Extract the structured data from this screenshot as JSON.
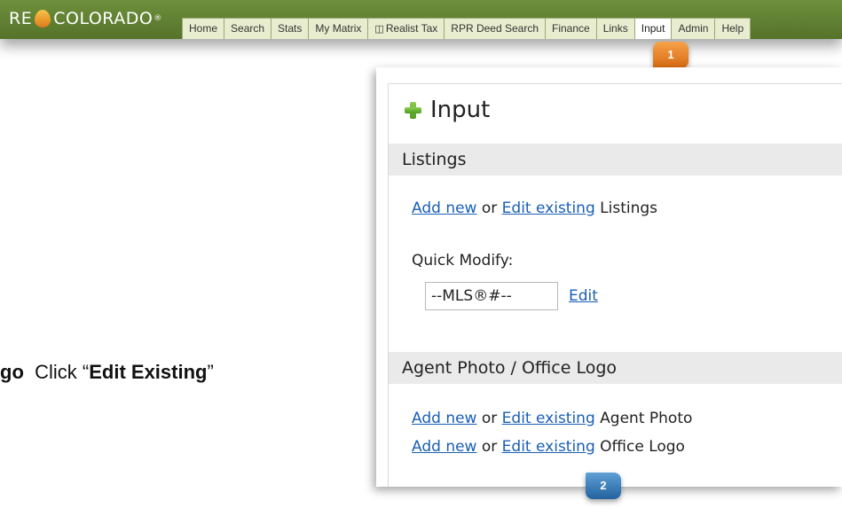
{
  "logo": {
    "part1": "RE",
    "part2": "COLORADO",
    "reg": "®"
  },
  "nav": {
    "tabs": [
      {
        "label": "Home"
      },
      {
        "label": "Search"
      },
      {
        "label": "Stats"
      },
      {
        "label": "My Matrix"
      },
      {
        "label": "Realist Tax"
      },
      {
        "label": "RPR Deed Search"
      },
      {
        "label": "Finance"
      },
      {
        "label": "Links"
      },
      {
        "label": "Input"
      },
      {
        "label": "Admin"
      },
      {
        "label": "Help"
      }
    ],
    "active": "Input"
  },
  "callouts": {
    "one": "1",
    "two": "2"
  },
  "instruction": {
    "prefix": "go",
    "click": "Click “",
    "target": "Edit Existing",
    "close": "”"
  },
  "panel": {
    "title": "Input",
    "listings": {
      "heading": "Listings",
      "add_new": "Add new",
      "or": "or",
      "edit_existing": "Edit existing",
      "suffix": "Listings",
      "quick_modify_label": "Quick Modify:",
      "mls_value": "--MLS®#--",
      "edit": "Edit"
    },
    "agent": {
      "heading": "Agent Photo / Office Logo",
      "row1": {
        "add_new": "Add new",
        "or": "or",
        "edit_existing": "Edit existing",
        "suffix": "Agent Photo"
      },
      "row2": {
        "add_new": "Add new",
        "or": "or",
        "edit_existing": "Edit existing",
        "suffix": "Office Logo"
      }
    }
  }
}
